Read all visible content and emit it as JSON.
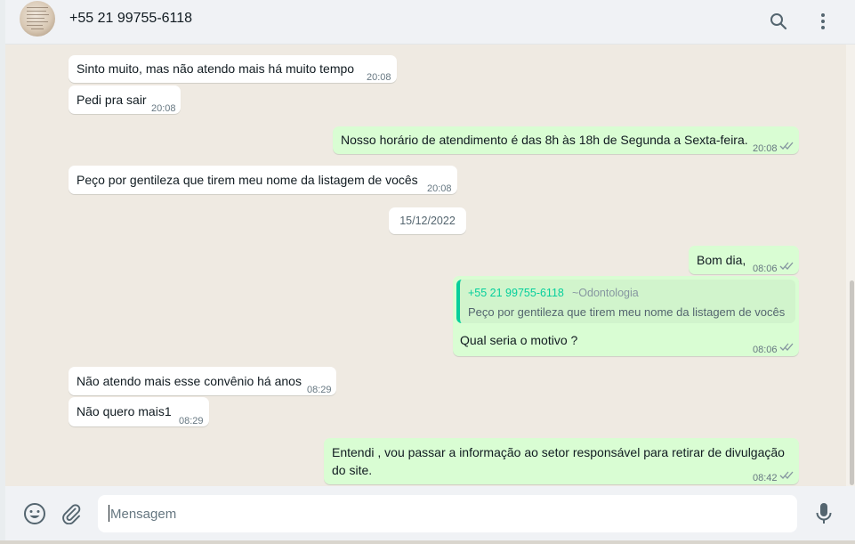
{
  "header": {
    "contact_name": "+55 21 99755-6118"
  },
  "messages": [
    {
      "direction": "in",
      "text": "Sinto muito, mas não atendo mais há muito tempo",
      "time": "20:08"
    },
    {
      "direction": "in",
      "text": "Pedi pra sair",
      "time": "20:08"
    },
    {
      "direction": "out",
      "text": "Nosso horário de atendimento é das 8h às 18h de Segunda a Sexta-feira.",
      "time": "20:08",
      "status": "read"
    },
    {
      "direction": "in",
      "text": "Peço por gentileza que tirem meu nome da listagem de vocês",
      "time": "20:08"
    },
    {
      "direction": "out",
      "text": "Bom dia,",
      "time": "08:06",
      "status": "read"
    },
    {
      "direction": "out",
      "text": "Qual seria o motivo ?",
      "time": "08:06",
      "status": "read",
      "quoted": {
        "author": "+55 21 99755-6118",
        "alias": "~Odontologia",
        "text": "Peço por gentileza que tirem meu nome da listagem de vocês"
      }
    },
    {
      "direction": "in",
      "text": "Não atendo mais esse convênio há anos",
      "time": "08:29"
    },
    {
      "direction": "in",
      "text": "Não quero mais1",
      "time": "08:29"
    },
    {
      "direction": "out",
      "text": "Entendi , vou passar a informação ao setor responsável para retirar de divulgação do site.",
      "time": "08:42",
      "status": "read"
    }
  ],
  "date_separator": "15/12/2022",
  "composer": {
    "placeholder": "Mensagem"
  },
  "colors": {
    "incoming_bubble": "#ffffff",
    "outgoing_bubble": "#d9fdd3",
    "chat_background": "#efeae2",
    "quote_accent": "#06cf9c"
  },
  "icons": [
    "search-icon",
    "menu-icon",
    "emoji-icon",
    "attach-icon",
    "mic-icon",
    "double-check-icon"
  ]
}
